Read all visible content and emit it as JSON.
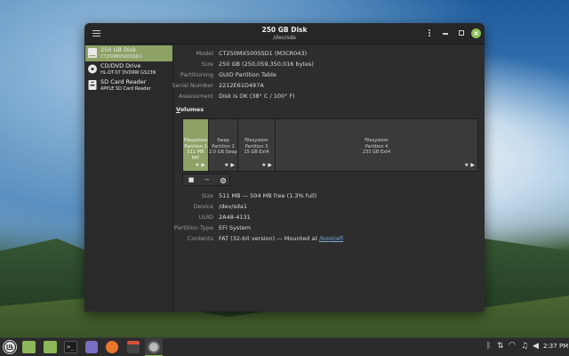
{
  "window": {
    "title": "250 GB Disk",
    "subtitle": "/dev/sda"
  },
  "sidebar": {
    "items": [
      {
        "name": "250 GB Disk",
        "model": "CT250MX500SSD1",
        "icon": "harddisk-icon",
        "selected": true
      },
      {
        "name": "CD/DVD Drive",
        "model": "HL-DT-ST DVDRW  GS23N",
        "icon": "optical-drive-icon",
        "selected": false
      },
      {
        "name": "SD Card Reader",
        "model": "APPLE SD Card Reader",
        "icon": "sd-card-icon",
        "selected": false
      }
    ]
  },
  "disk_info": [
    {
      "label": "Model",
      "value": "CT250MX500SSD1 (M3CR043)"
    },
    {
      "label": "Size",
      "value": "250 GB (250,059,350,016 bytes)"
    },
    {
      "label": "Partitioning",
      "value": "GUID Partition Table"
    },
    {
      "label": "Serial Number",
      "value": "2212E61D497A"
    },
    {
      "label": "Assessment",
      "value": "Disk is OK (38° C / 100° F)"
    }
  ],
  "volumes": {
    "heading": "Volumes",
    "partitions": [
      {
        "line1": "Filesystem",
        "line2": "Partition 1",
        "line3": "511 MB FAT",
        "selected": true,
        "icons": "★ ▶"
      },
      {
        "line1": "Swap",
        "line2": "Partition 2",
        "line3": "2.0 GB Swap",
        "selected": false,
        "icons": "★ ▶"
      },
      {
        "line1": "Filesystem",
        "line2": "Partition 3",
        "line3": "15 GB Ext4",
        "selected": false,
        "icons": "★ ▶"
      },
      {
        "line1": "Filesystem",
        "line2": "Partition 4",
        "line3": "233 GB Ext4",
        "selected": false,
        "icons": "★ ▶"
      }
    ],
    "tools": [
      {
        "glyph": "■",
        "icon": "stop-icon"
      },
      {
        "glyph": "−",
        "icon": "minus-icon"
      },
      {
        "glyph": "🔗",
        "icon": "settings-icon"
      }
    ]
  },
  "partition_info": [
    {
      "label": "Size",
      "value": "511 MB — 504 MB free (1.3% full)"
    },
    {
      "label": "Device",
      "value": "/dev/sda1"
    },
    {
      "label": "UUID",
      "value": "2A48-4131"
    },
    {
      "label": "Partition Type",
      "value": "EFI System"
    },
    {
      "label": "Contents",
      "value": "FAT (32-bit version) — Mounted at ",
      "link": "/boot/efi"
    }
  ],
  "taskbar": {
    "time": "2:37 PM",
    "apps": [
      "menu-icon",
      "folder-icon",
      "folder-icon",
      "terminal-icon",
      "text-editor-icon",
      "firefox-icon",
      "calculator-icon",
      "disks-icon"
    ],
    "tray": [
      "bluetooth-icon",
      "network-icon",
      "wifi-icon",
      "music-icon",
      "volume-icon"
    ]
  },
  "colors": {
    "accent": "#8da264",
    "window_bg": "#2d2d2d",
    "panel_bg": "#2b2b2b"
  }
}
